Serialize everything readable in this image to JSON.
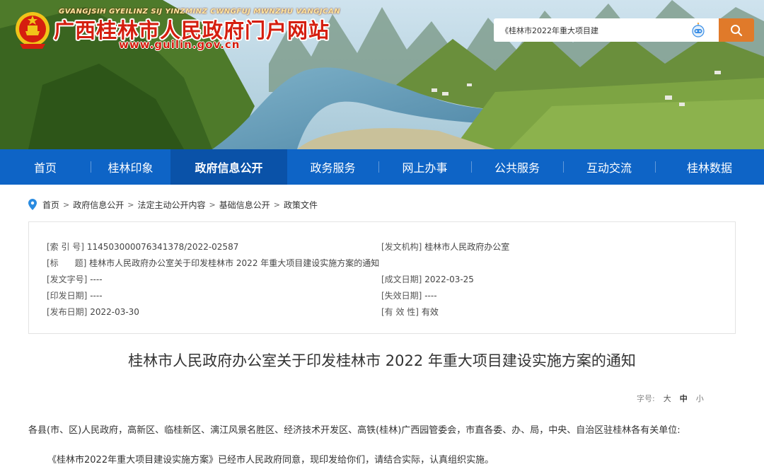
{
  "header": {
    "site_title": "广西桂林市人民政府门户网站",
    "site_title_zhuang": "GVANGJSIH GYEILINZ SIJ YINZMINZ CWNGFUJ MWNZHU VANGJCAN",
    "site_url": "www.guilin.gov.cn",
    "search": {
      "value": "《桂林市2022年重大项目建"
    },
    "colors": {
      "brand_red": "#d51e0f",
      "search_button": "#e07a2a"
    }
  },
  "nav": {
    "items": [
      {
        "label": "首页"
      },
      {
        "label": "桂林印象"
      },
      {
        "label": "政府信息公开",
        "active": true
      },
      {
        "label": "政务服务"
      },
      {
        "label": "网上办事"
      },
      {
        "label": "公共服务"
      },
      {
        "label": "互动交流"
      },
      {
        "label": "桂林数据"
      }
    ],
    "colors": {
      "background": "#0e64c6",
      "active": "#0a52a8"
    }
  },
  "breadcrumb": {
    "items": [
      "首页",
      "政府信息公开",
      "法定主动公开内容",
      "基础信息公开",
      "政策文件"
    ],
    "separator": ">"
  },
  "info": {
    "index_no": {
      "key": "[索 引 号]",
      "value": "114503000076341378/2022-02587"
    },
    "issuer": {
      "key": "[发文机构]",
      "value": "桂林市人民政府办公室"
    },
    "title": {
      "key": "[标      题]",
      "value": "桂林市人民政府办公室关于印发桂林市 2022 年重大项目建设实施方案的通知"
    },
    "doc_no": {
      "key": "[发文字号]",
      "value": "----"
    },
    "written_date": {
      "key": "[成文日期]",
      "value": "2022-03-25"
    },
    "print_date": {
      "key": "[印发日期]",
      "value": "----"
    },
    "expire_date": {
      "key": "[失效日期]",
      "value": "----"
    },
    "publish_date": {
      "key": "[发布日期]",
      "value": "2022-03-30"
    },
    "validity": {
      "key": "[有 效 性]",
      "value": "有效"
    }
  },
  "article": {
    "title": "桂林市人民政府办公室关于印发桂林市 2022 年重大项目建设实施方案的通知",
    "font_size": {
      "label": "字号:",
      "large": "大",
      "medium": "中",
      "small": "小"
    },
    "paragraphs": [
      "各县(市、区)人民政府，高新区、临桂新区、漓江风景名胜区、经济技术开发区、高铁(桂林)广西园管委会，市直各委、办、局，中央、自治区驻桂林各有关单位:",
      "《桂林市2022年重大项目建设实施方案》已经市人民政府同意，现印发给你们，请结合实际，认真组织实施。"
    ]
  }
}
